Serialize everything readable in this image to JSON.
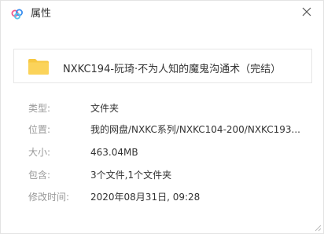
{
  "window": {
    "title": "属性",
    "close_icon": "close-icon",
    "app_icon": "cloud-icon"
  },
  "file": {
    "icon": "folder-icon",
    "name": "NXKC194-阮琦·不为人知的魔鬼沟通术（完结）"
  },
  "properties": [
    {
      "label": "类型:",
      "value": "文件夹"
    },
    {
      "label": "位置:",
      "value": "我的网盘/NXKC系列/NXKC104-200/NXKC193..."
    },
    {
      "label": "大小:",
      "value": "463.04MB"
    },
    {
      "label": "包含:",
      "value": "3个文件,1个文件夹"
    },
    {
      "label": "修改时间:",
      "value": "2020年08月31日, 09:28"
    }
  ],
  "colors": {
    "folder": "#f7c843",
    "cloud_pink": "#ef5c8b",
    "cloud_blue": "#3a8ff0",
    "label": "#999999",
    "text": "#333333"
  }
}
